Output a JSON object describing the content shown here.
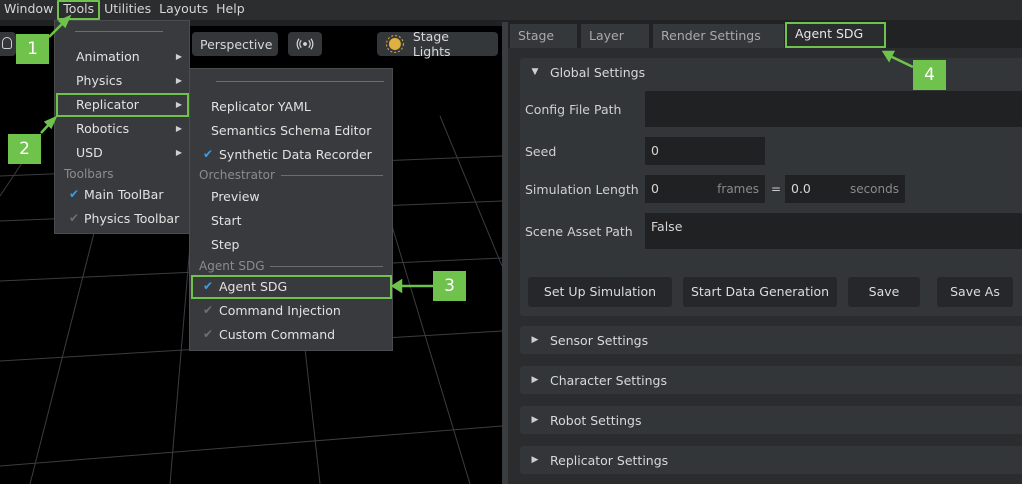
{
  "menubar": {
    "items": [
      "Window",
      "Tools",
      "Utilities",
      "Layouts",
      "Help"
    ]
  },
  "viewport": {
    "perspective_label": "Perspective",
    "stage_lights_label": "Stage Lights"
  },
  "tools_menu": {
    "items": [
      "Animation",
      "Physics",
      "Replicator",
      "Robotics",
      "USD"
    ],
    "toolbars_group": "Toolbars",
    "toolbar_items": [
      "Main ToolBar",
      "Physics Toolbar"
    ]
  },
  "replicator_menu": {
    "items": [
      "Replicator YAML",
      "Semantics Schema Editor",
      "Synthetic Data Recorder"
    ],
    "orchestrator_group": "Orchestrator",
    "orchestrator_items": [
      "Preview",
      "Start",
      "Step"
    ],
    "agent_group": "Agent SDG",
    "agent_items": [
      "Agent SDG",
      "Command Injection",
      "Custom Command"
    ]
  },
  "tabs": [
    "Stage",
    "Layer",
    "Render Settings",
    "Agent SDG"
  ],
  "global": {
    "title": "Global Settings",
    "config_label": "Config File Path",
    "config_value": "",
    "seed_label": "Seed",
    "seed_value": "0",
    "sim_label": "Simulation Length",
    "sim_frames": "0",
    "frames_unit": "frames",
    "equals": "=",
    "sim_seconds": "0.0",
    "seconds_unit": "seconds",
    "scene_label": "Scene Asset Path",
    "scene_value": "False",
    "buttons": [
      "Set Up Simulation",
      "Start Data Generation",
      "Save",
      "Save As"
    ]
  },
  "sections": [
    "Sensor Settings",
    "Character Settings",
    "Robot Settings",
    "Replicator Settings"
  ],
  "callouts": [
    "1",
    "2",
    "3",
    "4"
  ],
  "colors": {
    "highlight": "#6fc24c",
    "check": "#3f9be6",
    "background": "#1f2123"
  }
}
